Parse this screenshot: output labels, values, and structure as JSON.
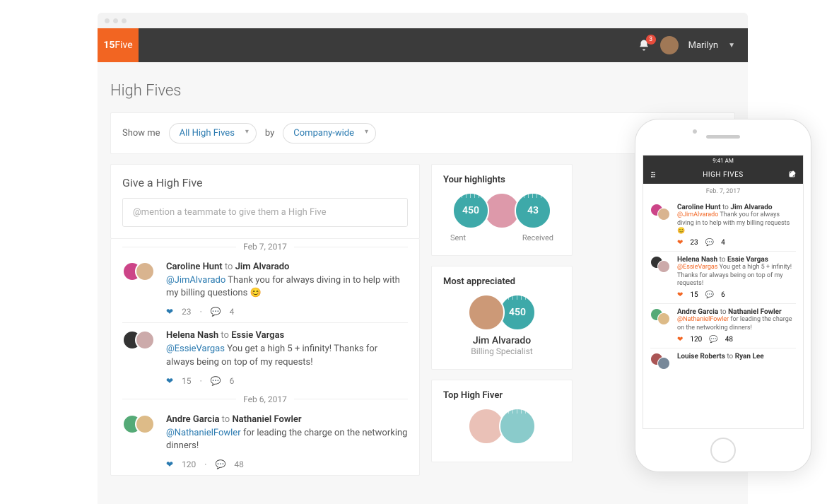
{
  "nav": {
    "logo_a": "15",
    "logo_b": "Five",
    "notif_count": "3",
    "username": "Marilyn"
  },
  "page": {
    "title": "High Fives",
    "filter": {
      "show_me_label": "Show me",
      "show_me_value": "All High Fives",
      "by_label": "by",
      "by_value": "Company-wide"
    }
  },
  "give": {
    "title": "Give a High Five",
    "placeholder": "@mention a teammate to give them a High Five"
  },
  "feed": [
    {
      "date": "Feb 7, 2017",
      "items": [
        {
          "from": "Caroline Hunt",
          "to": "Jim Alvarado",
          "mention": "@JimAlvarado",
          "msg": "Thank you for always diving in to help with my billing questions 😊",
          "likes": "23",
          "comments": "4"
        },
        {
          "from": "Helena Nash",
          "to": "Essie Vargas",
          "mention": "@EssieVargas",
          "msg": "You get a high 5 + infinity! Thanks for always being on top of my requests!",
          "likes": "15",
          "comments": "6"
        }
      ]
    },
    {
      "date": "Feb 6, 2017",
      "items": [
        {
          "from": "Andre Garcia",
          "to": "Nathaniel Fowler",
          "mention": "@NathanielFowler",
          "msg": "for leading the charge on the networking dinners!",
          "likes": "120",
          "comments": "48"
        }
      ]
    }
  ],
  "highlights": {
    "title": "Your highlights",
    "sent_value": "450",
    "sent_label": "Sent",
    "received_value": "43",
    "received_label": "Received"
  },
  "most": {
    "title": "Most appreciated",
    "badge": "450",
    "name": "Jim Alvarado",
    "role": "Billing Specialist"
  },
  "top_fiver": {
    "title": "Top High Fiver"
  },
  "phone": {
    "status_time": "9:41 AM",
    "header": "HIGH FIVES",
    "date": "Feb. 7, 2017",
    "items": [
      {
        "from": "Caroline Hunt",
        "to": "Jim Alvarado",
        "mention": "@JimAlvarado",
        "msg": "Thank you for always diving in to help with my billing requests 😊",
        "likes": "23",
        "comments": "4"
      },
      {
        "from": "Helena Nash",
        "to": "Essie Vargas",
        "mention": "@EssieVargas",
        "msg": "You get a high 5 + infinity! Thanks for always being on top of my requests!",
        "likes": "15",
        "comments": "6"
      },
      {
        "from": "Andre Garcia",
        "to": "Nathaniel Fowler",
        "mention": "@NathanielFowler",
        "msg": "for leading the charge on the networking dinners!",
        "likes": "120",
        "comments": "48"
      },
      {
        "from": "Louise Roberts",
        "to": "Ryan Lee",
        "mention": "",
        "msg": "",
        "likes": "",
        "comments": ""
      }
    ]
  }
}
